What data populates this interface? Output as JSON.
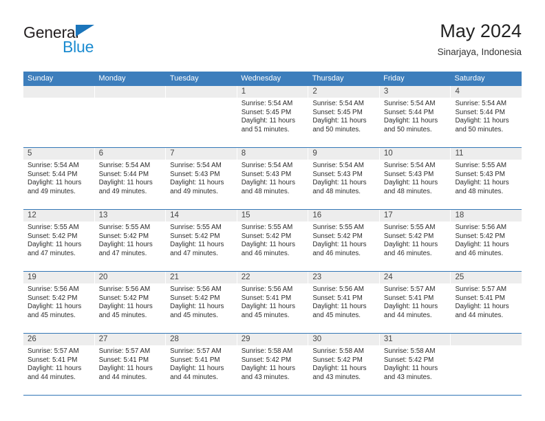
{
  "brand": {
    "name_top": "General",
    "name_bottom": "Blue",
    "accent_color": "#1b75bb",
    "blue_text_color": "#1b8bd0"
  },
  "header": {
    "title": "May 2024",
    "subtitle": "Sinarjaya, Indonesia"
  },
  "theme": {
    "header_row_bg": "#3d7ebc",
    "week_separator": "#2f74b5",
    "daynum_bg": "#ededed",
    "text": "#2b2b2b"
  },
  "calendar": {
    "weekday_headers": [
      "Sunday",
      "Monday",
      "Tuesday",
      "Wednesday",
      "Thursday",
      "Friday",
      "Saturday"
    ],
    "weeks": [
      [
        {
          "day": "",
          "empty": true
        },
        {
          "day": "",
          "empty": true
        },
        {
          "day": "",
          "empty": true
        },
        {
          "day": "1",
          "sunrise": "Sunrise: 5:54 AM",
          "sunset": "Sunset: 5:45 PM",
          "daylight": "Daylight: 11 hours and 51 minutes."
        },
        {
          "day": "2",
          "sunrise": "Sunrise: 5:54 AM",
          "sunset": "Sunset: 5:45 PM",
          "daylight": "Daylight: 11 hours and 50 minutes."
        },
        {
          "day": "3",
          "sunrise": "Sunrise: 5:54 AM",
          "sunset": "Sunset: 5:44 PM",
          "daylight": "Daylight: 11 hours and 50 minutes."
        },
        {
          "day": "4",
          "sunrise": "Sunrise: 5:54 AM",
          "sunset": "Sunset: 5:44 PM",
          "daylight": "Daylight: 11 hours and 50 minutes."
        }
      ],
      [
        {
          "day": "5",
          "sunrise": "Sunrise: 5:54 AM",
          "sunset": "Sunset: 5:44 PM",
          "daylight": "Daylight: 11 hours and 49 minutes."
        },
        {
          "day": "6",
          "sunrise": "Sunrise: 5:54 AM",
          "sunset": "Sunset: 5:44 PM",
          "daylight": "Daylight: 11 hours and 49 minutes."
        },
        {
          "day": "7",
          "sunrise": "Sunrise: 5:54 AM",
          "sunset": "Sunset: 5:43 PM",
          "daylight": "Daylight: 11 hours and 49 minutes."
        },
        {
          "day": "8",
          "sunrise": "Sunrise: 5:54 AM",
          "sunset": "Sunset: 5:43 PM",
          "daylight": "Daylight: 11 hours and 48 minutes."
        },
        {
          "day": "9",
          "sunrise": "Sunrise: 5:54 AM",
          "sunset": "Sunset: 5:43 PM",
          "daylight": "Daylight: 11 hours and 48 minutes."
        },
        {
          "day": "10",
          "sunrise": "Sunrise: 5:54 AM",
          "sunset": "Sunset: 5:43 PM",
          "daylight": "Daylight: 11 hours and 48 minutes."
        },
        {
          "day": "11",
          "sunrise": "Sunrise: 5:55 AM",
          "sunset": "Sunset: 5:43 PM",
          "daylight": "Daylight: 11 hours and 48 minutes."
        }
      ],
      [
        {
          "day": "12",
          "sunrise": "Sunrise: 5:55 AM",
          "sunset": "Sunset: 5:42 PM",
          "daylight": "Daylight: 11 hours and 47 minutes."
        },
        {
          "day": "13",
          "sunrise": "Sunrise: 5:55 AM",
          "sunset": "Sunset: 5:42 PM",
          "daylight": "Daylight: 11 hours and 47 minutes."
        },
        {
          "day": "14",
          "sunrise": "Sunrise: 5:55 AM",
          "sunset": "Sunset: 5:42 PM",
          "daylight": "Daylight: 11 hours and 47 minutes."
        },
        {
          "day": "15",
          "sunrise": "Sunrise: 5:55 AM",
          "sunset": "Sunset: 5:42 PM",
          "daylight": "Daylight: 11 hours and 46 minutes."
        },
        {
          "day": "16",
          "sunrise": "Sunrise: 5:55 AM",
          "sunset": "Sunset: 5:42 PM",
          "daylight": "Daylight: 11 hours and 46 minutes."
        },
        {
          "day": "17",
          "sunrise": "Sunrise: 5:55 AM",
          "sunset": "Sunset: 5:42 PM",
          "daylight": "Daylight: 11 hours and 46 minutes."
        },
        {
          "day": "18",
          "sunrise": "Sunrise: 5:56 AM",
          "sunset": "Sunset: 5:42 PM",
          "daylight": "Daylight: 11 hours and 46 minutes."
        }
      ],
      [
        {
          "day": "19",
          "sunrise": "Sunrise: 5:56 AM",
          "sunset": "Sunset: 5:42 PM",
          "daylight": "Daylight: 11 hours and 45 minutes."
        },
        {
          "day": "20",
          "sunrise": "Sunrise: 5:56 AM",
          "sunset": "Sunset: 5:42 PM",
          "daylight": "Daylight: 11 hours and 45 minutes."
        },
        {
          "day": "21",
          "sunrise": "Sunrise: 5:56 AM",
          "sunset": "Sunset: 5:42 PM",
          "daylight": "Daylight: 11 hours and 45 minutes."
        },
        {
          "day": "22",
          "sunrise": "Sunrise: 5:56 AM",
          "sunset": "Sunset: 5:41 PM",
          "daylight": "Daylight: 11 hours and 45 minutes."
        },
        {
          "day": "23",
          "sunrise": "Sunrise: 5:56 AM",
          "sunset": "Sunset: 5:41 PM",
          "daylight": "Daylight: 11 hours and 45 minutes."
        },
        {
          "day": "24",
          "sunrise": "Sunrise: 5:57 AM",
          "sunset": "Sunset: 5:41 PM",
          "daylight": "Daylight: 11 hours and 44 minutes."
        },
        {
          "day": "25",
          "sunrise": "Sunrise: 5:57 AM",
          "sunset": "Sunset: 5:41 PM",
          "daylight": "Daylight: 11 hours and 44 minutes."
        }
      ],
      [
        {
          "day": "26",
          "sunrise": "Sunrise: 5:57 AM",
          "sunset": "Sunset: 5:41 PM",
          "daylight": "Daylight: 11 hours and 44 minutes."
        },
        {
          "day": "27",
          "sunrise": "Sunrise: 5:57 AM",
          "sunset": "Sunset: 5:41 PM",
          "daylight": "Daylight: 11 hours and 44 minutes."
        },
        {
          "day": "28",
          "sunrise": "Sunrise: 5:57 AM",
          "sunset": "Sunset: 5:41 PM",
          "daylight": "Daylight: 11 hours and 44 minutes."
        },
        {
          "day": "29",
          "sunrise": "Sunrise: 5:58 AM",
          "sunset": "Sunset: 5:42 PM",
          "daylight": "Daylight: 11 hours and 43 minutes."
        },
        {
          "day": "30",
          "sunrise": "Sunrise: 5:58 AM",
          "sunset": "Sunset: 5:42 PM",
          "daylight": "Daylight: 11 hours and 43 minutes."
        },
        {
          "day": "31",
          "sunrise": "Sunrise: 5:58 AM",
          "sunset": "Sunset: 5:42 PM",
          "daylight": "Daylight: 11 hours and 43 minutes."
        },
        {
          "day": "",
          "empty": true
        }
      ]
    ]
  }
}
